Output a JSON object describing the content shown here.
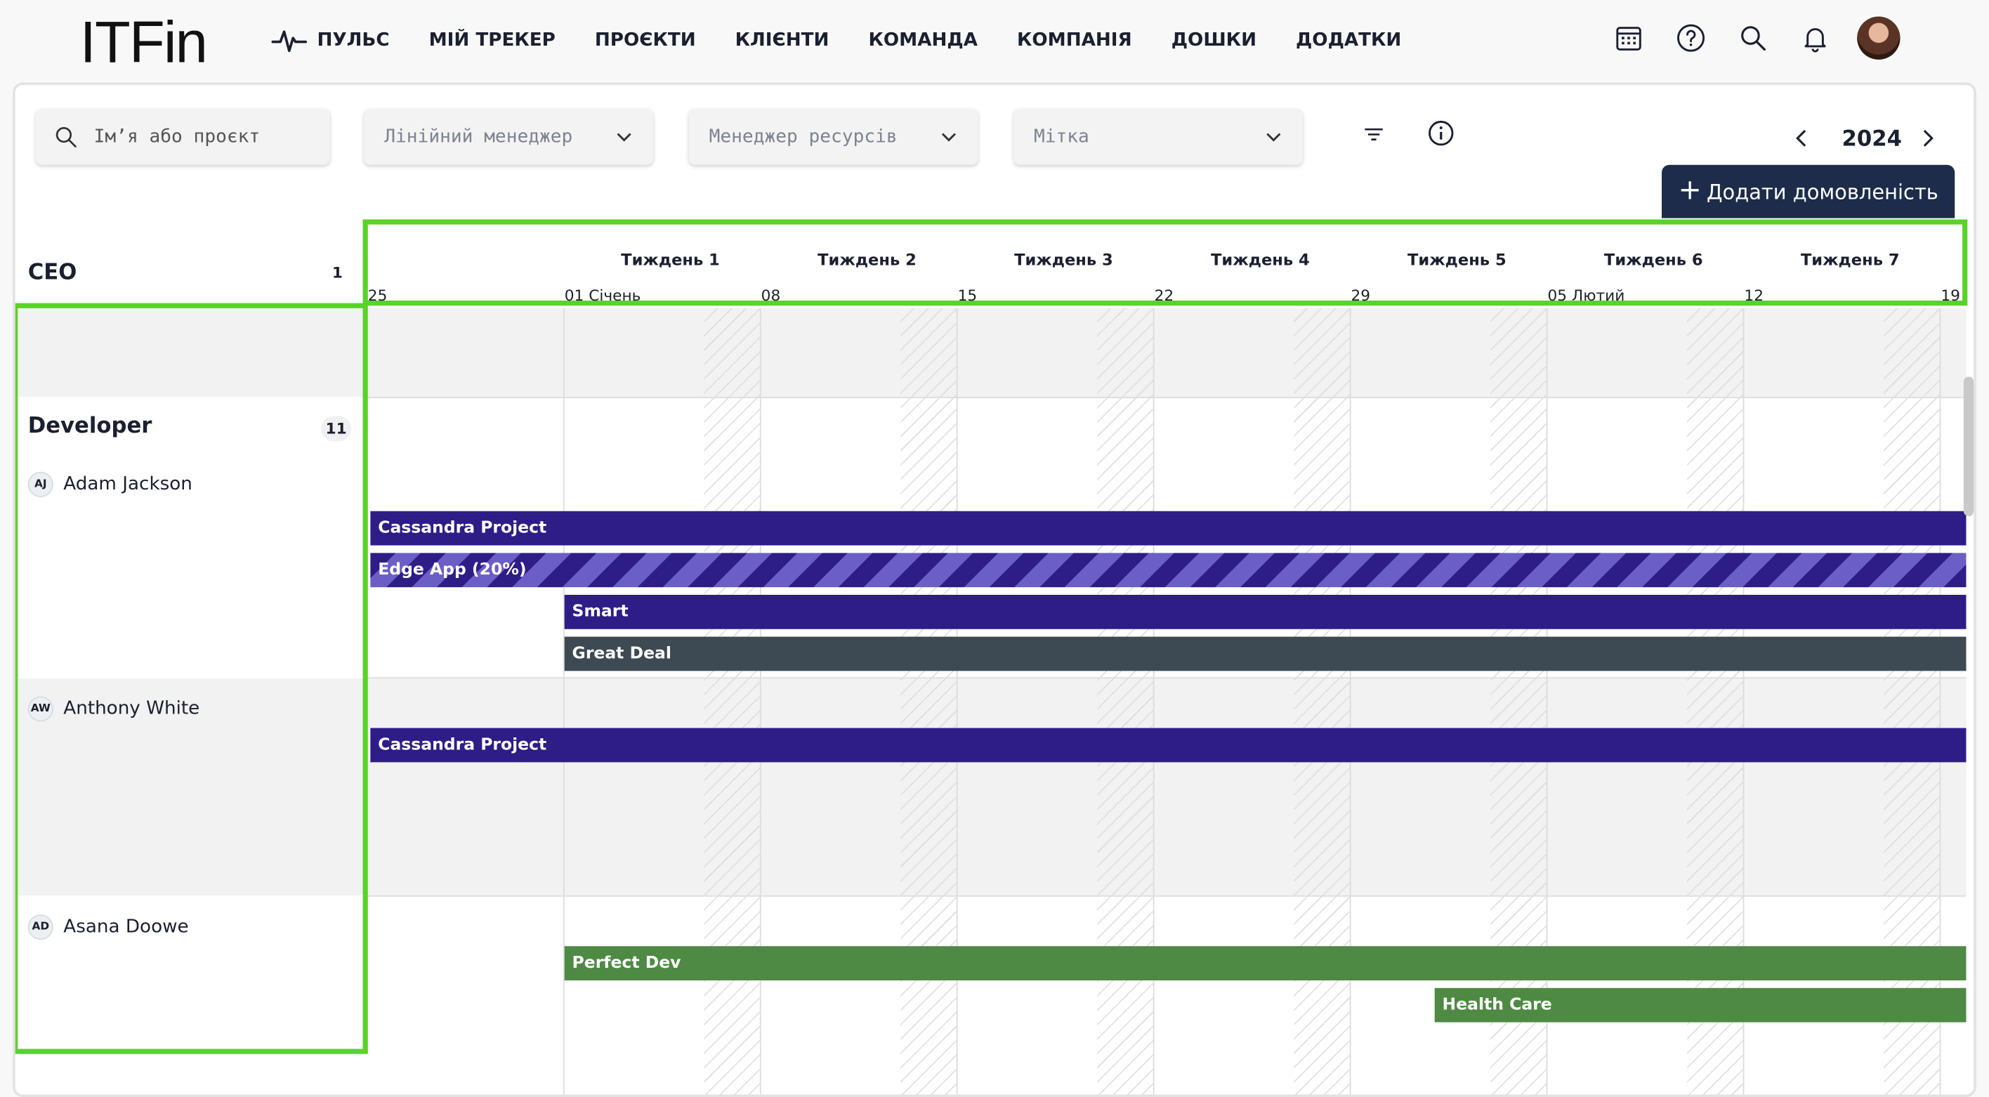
{
  "app": {
    "logo": "ITFin"
  },
  "nav": {
    "items": [
      {
        "label": "ПУЛЬС",
        "icon": "pulse-icon"
      },
      {
        "label": "МІЙ ТРЕКЕР"
      },
      {
        "label": "ПРОЄКТИ"
      },
      {
        "label": "КЛІЄНТИ"
      },
      {
        "label": "КОМАНДА"
      },
      {
        "label": "КОМПАНІЯ"
      },
      {
        "label": "ДОШКИ"
      },
      {
        "label": "ДОДАТКИ"
      }
    ],
    "icons": [
      "calendar-icon",
      "help-icon",
      "search-icon",
      "bell-icon",
      "user-avatar"
    ]
  },
  "filters": {
    "search_placeholder": "Ім’я або проєкт",
    "line_manager_placeholder": "Лінійний менеджер",
    "resource_manager_placeholder": "Менеджер ресурсів",
    "tag_placeholder": "Мітка"
  },
  "year_nav": {
    "year": "2024"
  },
  "actions": {
    "add_agreement": "Додати домовленість"
  },
  "timeline": {
    "weeks": [
      "Тиждень 1",
      "Тиждень 2",
      "Тиждень 3",
      "Тиждень 4",
      "Тиждень 5",
      "Тиждень 6",
      "Тиждень 7"
    ],
    "dates": [
      "25",
      "01 Січень",
      "08",
      "15",
      "22",
      "29",
      "05 Лютий",
      "12",
      "19"
    ]
  },
  "groups": [
    {
      "title": "CEO",
      "count": "1"
    },
    {
      "title": "Developer",
      "count": "11"
    }
  ],
  "people": [
    {
      "initials": "AJ",
      "name": "Adam Jackson",
      "assignments": [
        "Cassandra Project",
        "Edge App (20%)",
        "Smart",
        "Great Deal"
      ]
    },
    {
      "initials": "AW",
      "name": "Anthony White",
      "assignments": [
        "Cassandra Project"
      ]
    },
    {
      "initials": "AD",
      "name": "Asana Doowe",
      "assignments": [
        "Perfect Dev",
        "Health Care"
      ]
    }
  ],
  "colors": {
    "bar_primary": "#2e1d87",
    "bar_striped": "#6c5ec7",
    "bar_dark": "#3e4a53",
    "bar_green": "#4e8a43",
    "button": "#1c2c4a",
    "highlight": "#5ad22a"
  }
}
